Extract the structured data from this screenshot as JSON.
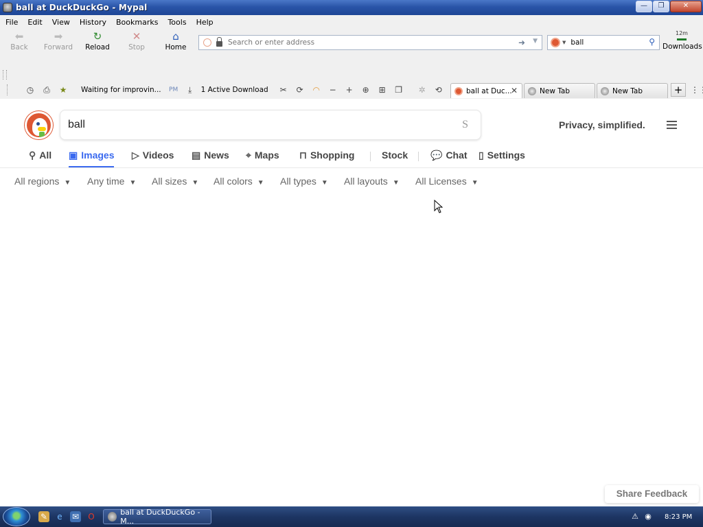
{
  "window": {
    "title": "ball at DuckDuckGo - Mypal"
  },
  "menubar": {
    "items": [
      {
        "label": "File",
        "key": "F"
      },
      {
        "label": "Edit",
        "key": "E"
      },
      {
        "label": "View",
        "key": "V"
      },
      {
        "label": "History",
        "key": "H"
      },
      {
        "label": "Bookmarks",
        "key": "B"
      },
      {
        "label": "Tools",
        "key": "T"
      },
      {
        "label": "Help",
        "key": "H"
      }
    ]
  },
  "toolbar": {
    "back": "Back",
    "forward": "Forward",
    "reload": "Reload",
    "stop": "Stop",
    "home": "Home",
    "downloads": "Downloads",
    "downloads_count": "12m"
  },
  "urlbar": {
    "placeholder": "Search or enter address",
    "value": ""
  },
  "searchbar": {
    "value": "ball"
  },
  "statusbar": {
    "status": "Waiting for improvin...",
    "downloads": "1 Active Download"
  },
  "tabs": [
    {
      "label": "ball at Duc...",
      "active": true
    },
    {
      "label": "New Tab",
      "active": false
    },
    {
      "label": "New Tab",
      "active": false
    }
  ],
  "page": {
    "query": "ball",
    "search_button_glyph": "S",
    "tagline": "Privacy, simplified.",
    "nav": [
      {
        "label": "All",
        "icon": "search-icon",
        "active": false
      },
      {
        "label": "Images",
        "icon": "image-icon",
        "active": true
      },
      {
        "label": "Videos",
        "icon": "play-icon",
        "active": false
      },
      {
        "label": "News",
        "icon": "newspaper-icon",
        "active": false
      },
      {
        "label": "Maps",
        "icon": "pin-icon",
        "active": false
      },
      {
        "label": "Shopping",
        "icon": "bag-icon",
        "active": false
      },
      {
        "label": "Stock",
        "icon": "",
        "active": false
      },
      {
        "label": "Chat",
        "icon": "chat-icon",
        "active": false
      },
      {
        "label": "Settings",
        "icon": "settings-icon",
        "active": false
      }
    ],
    "filters": [
      "All regions",
      "Any time",
      "All sizes",
      "All colors",
      "All types",
      "All layouts",
      "All Licenses"
    ],
    "share_feedback": "Share Feedback"
  },
  "taskbar": {
    "window_button": "ball at DuckDuckGo - M...",
    "clock": "8:23 PM"
  },
  "colors": {
    "ddg_accent": "#3969ef",
    "ddg_orange": "#de5833",
    "titlebar": "#2a55a8"
  }
}
